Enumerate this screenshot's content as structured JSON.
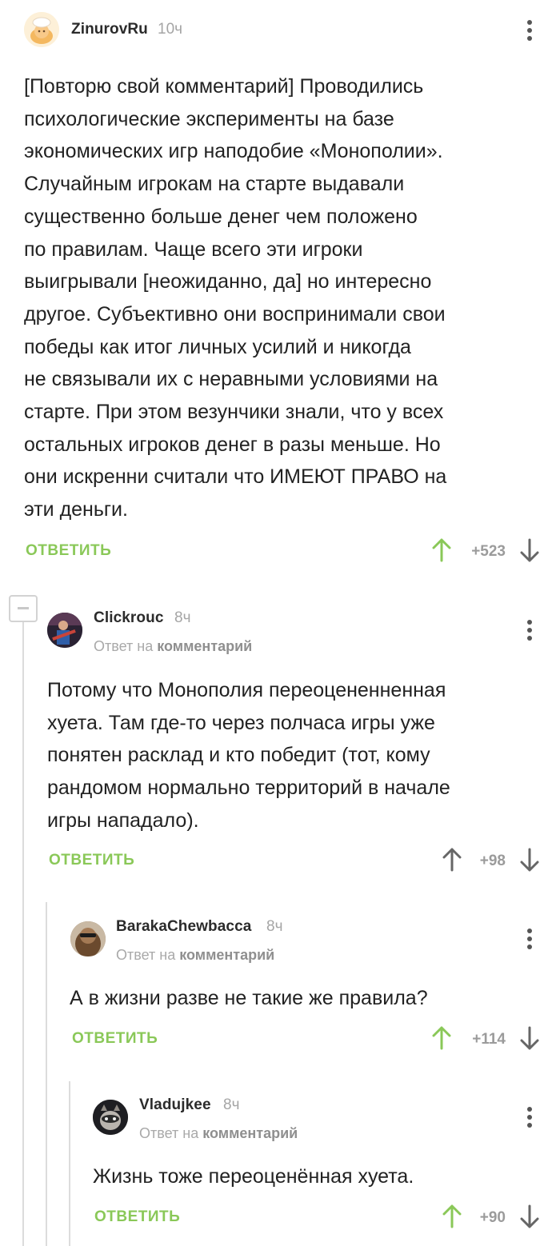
{
  "colors": {
    "accent_green": "#8ac858",
    "text": "#222222",
    "muted": "#a5a5a5",
    "thread_line": "#dcdcdc"
  },
  "labels": {
    "reply": "ОТВЕТИТЬ",
    "reply_to_prefix": "Ответ на",
    "reply_to_target": "комментарий"
  },
  "comments": [
    {
      "user": "ZinurovRu",
      "time": "10ч",
      "text": "[Повторю свой комментарий] Проводились\nпсихологические эксперименты на базе\nэкономических игр наподобие «Монополии».\nСлучайным игрокам на старте выдавали\nсущественно больше денег чем положено\nпо правилам. Чаще всего эти игроки\nвыигрывали [неожиданно, да] но интересно\nдругое. Субъективно они воспринимали свои\nпобеды как итог личных усилий и никогда\nне связывали их с неравными условиями на\nстарте. При этом везунчики знали, что у всех\nостальных игроков денег в разы меньше. Но\nони искренни считали что ИМЕЮТ ПРАВО на\nэти деньги.",
      "rating": "+523",
      "voted_up": true
    },
    {
      "user": "Clickrouc",
      "time": "8ч",
      "text": "Потому что Монополия переоцененненная\nхуета. Там где-то через полчаса игры уже\nпонятен расклад и кто победит (тот, кому\nрандомом нормально территорий в начале\nигры нападало).",
      "rating": "+98",
      "voted_up": false
    },
    {
      "user": "BarakaChewbacca",
      "time": "8ч",
      "text": "А в жизни разве не такие же правила?",
      "rating": "+114",
      "voted_up": true
    },
    {
      "user": "Vladujkee",
      "time": "8ч",
      "text": "Жизнь тоже переоценённая хуета.",
      "rating": "+90",
      "voted_up": true
    }
  ]
}
